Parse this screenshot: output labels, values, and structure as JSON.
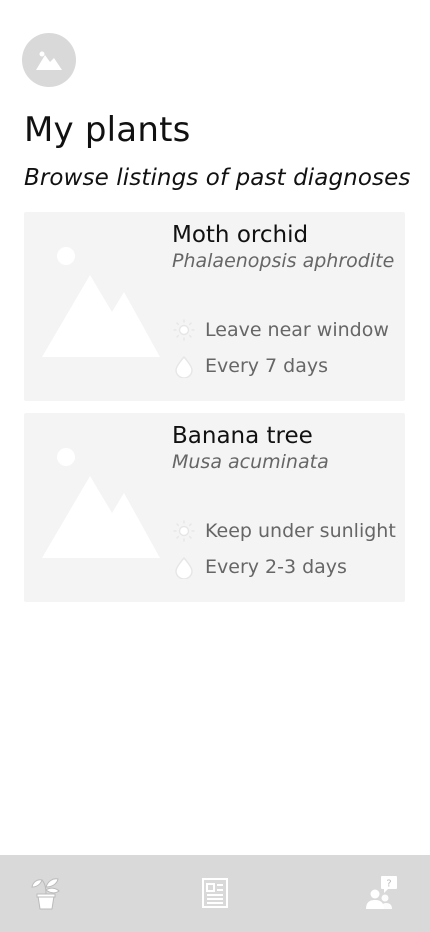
{
  "header": {
    "avatar_icon": "image-placeholder-icon",
    "title": "My plants",
    "subtitle": "Browse listings of past diagnoses"
  },
  "plants": [
    {
      "common_name": "Moth orchid",
      "scientific_name": "Phalaenopsis aphrodite",
      "light_icon": "sun-icon",
      "light": "Leave near window",
      "water_icon": "water-drop-icon",
      "water": "Every 7 days"
    },
    {
      "common_name": "Banana tree",
      "scientific_name": "Musa acuminata",
      "light_icon": "sun-icon",
      "light": "Keep under sunlight",
      "water_icon": "water-drop-icon",
      "water": "Every 2-3 days"
    }
  ],
  "bottom_nav": {
    "items": [
      {
        "icon": "potted-plant-icon"
      },
      {
        "icon": "newspaper-icon"
      },
      {
        "icon": "ask-expert-icon"
      }
    ]
  },
  "colors": {
    "card_bg": "#f4f4f4",
    "nav_bg": "#d9d9d9",
    "placeholder": "#ffffff",
    "secondary_text": "#666666"
  }
}
